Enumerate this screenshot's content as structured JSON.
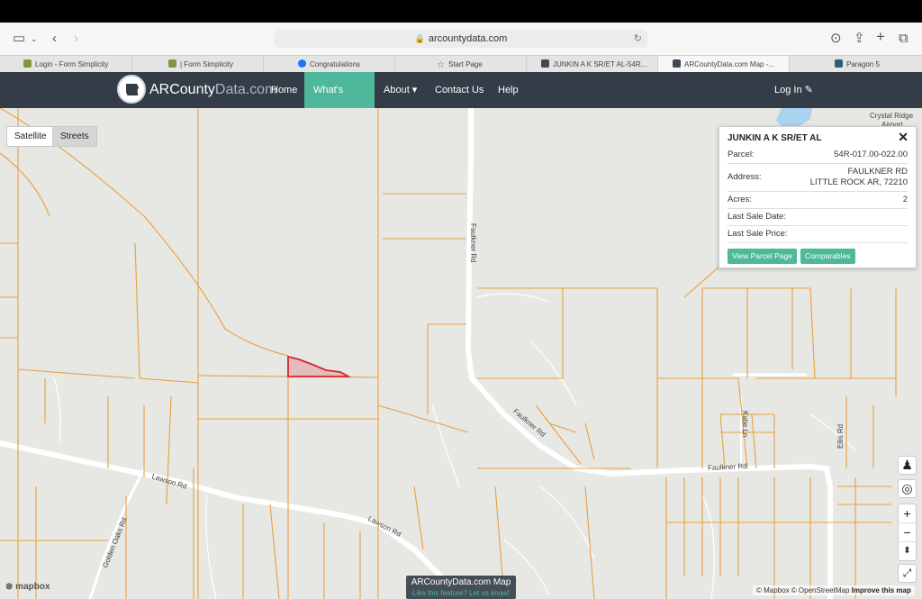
{
  "browser": {
    "url": "arcountydata.com",
    "tabs": [
      {
        "label": "Login - Form Simplicity",
        "icon": "form-icon",
        "color": "#7c9a3c"
      },
      {
        "label": "| Form Simplicity",
        "icon": "form-icon",
        "color": "#7c9a3c"
      },
      {
        "label": "Congratulations",
        "icon": "facebook-icon",
        "color": "#1877f2"
      },
      {
        "label": "Start Page",
        "icon": "star-icon",
        "color": "#888888"
      },
      {
        "label": "JUNKIN A K SR/ET AL-54R...",
        "icon": "arcounty-icon",
        "color": "#3d4a57"
      },
      {
        "label": "ARCountyData.com Map -...",
        "icon": "arcounty-icon",
        "color": "#3d4a57"
      },
      {
        "label": "Paragon 5",
        "icon": "paragon-icon",
        "color": "#2c5f73"
      }
    ]
  },
  "navbar": {
    "brand_main": "ARCounty",
    "brand_dim": "Data.com",
    "links": [
      "Home",
      "What's New?",
      "About ▾",
      "Contact Us",
      "Help"
    ],
    "login": "Log In"
  },
  "map": {
    "toggles": [
      "Satellite",
      "Streets"
    ],
    "road_labels": [
      "Faulkner Rd",
      "Faulkner Rd",
      "Faulkner Rd",
      "Lawson Rd",
      "Lawson Rd",
      "Katie Ln",
      "Ellis Rd",
      "Golden Oaks Rd",
      "Crystal Ridge",
      "Airport"
    ],
    "mapbox": "mapbox",
    "attribution": [
      "© Mapbox",
      "© OpenStreetMap",
      "Improve this map"
    ],
    "center_label": {
      "title": "ARCountyData.com Map",
      "subtitle": "Like this feature? Let us know!"
    },
    "colors": {
      "parcel_line": "#e8a040",
      "selected_parcel": "#d9242b",
      "road": "#ffffff"
    }
  },
  "popup": {
    "title": "JUNKIN A K SR/ET AL",
    "rows": [
      {
        "label": "Parcel:",
        "value": "54R-017.00-022.00"
      },
      {
        "label": "Address:",
        "value": "FAULKNER RD",
        "value2": "LITTLE ROCK AR, 72210"
      },
      {
        "label": "Acres:",
        "value": "2"
      },
      {
        "label": "Last Sale Date:",
        "value": ""
      },
      {
        "label": "Last Sale Price:",
        "value": ""
      }
    ],
    "buttons": [
      "View Parcel Page",
      "Comparables"
    ]
  }
}
